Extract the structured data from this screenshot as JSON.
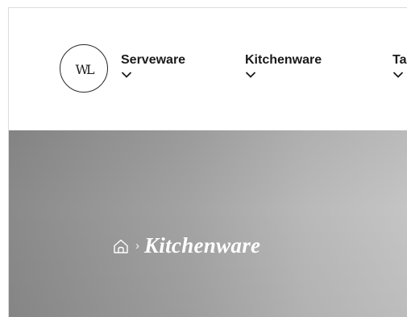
{
  "logo": {
    "text": "WL"
  },
  "nav": {
    "items": [
      {
        "label": "Serveware"
      },
      {
        "label": "Kitchenware"
      },
      {
        "label": "Ta"
      }
    ]
  },
  "hero": {
    "breadcrumb": {
      "home_icon": "home-icon",
      "separator": "›",
      "current": "Kitchenware"
    }
  },
  "colors": {
    "hero_dark": "#8a8a8a",
    "hero_light": "#c4c4c4",
    "nav_text": "#1a1a1a",
    "breadcrumb_text": "#ffffff"
  }
}
